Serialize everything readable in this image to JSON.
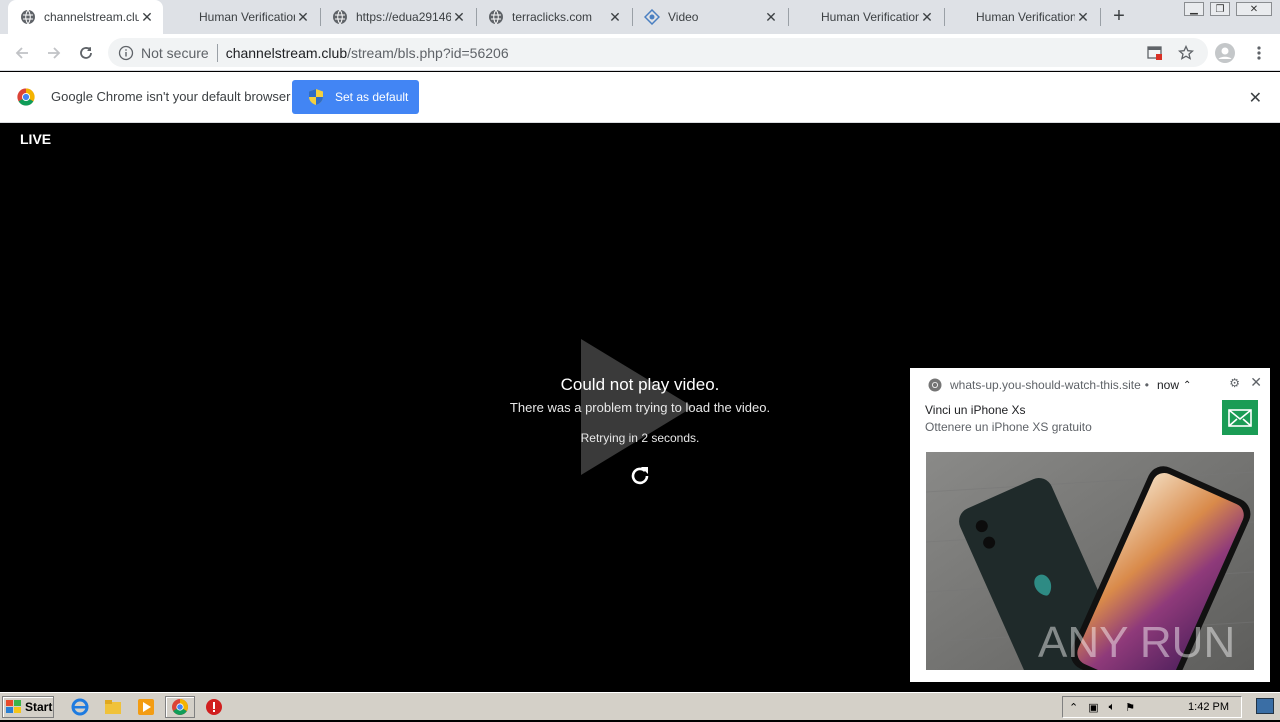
{
  "tabs": [
    {
      "title": "channelstream.club",
      "icon": "globe-icon",
      "active": true
    },
    {
      "title": "Human Verification",
      "icon": "none"
    },
    {
      "title": "https://edua29146",
      "icon": "globe-icon"
    },
    {
      "title": "terraclicks.com",
      "icon": "globe-icon"
    },
    {
      "title": "Video",
      "icon": "video-site-icon"
    },
    {
      "title": "Human Verification",
      "icon": "none"
    },
    {
      "title": "Human Verification",
      "icon": "none"
    }
  ],
  "toolbar": {
    "security_label": "Not secure",
    "url_host": "channelstream.club",
    "url_path": "/stream/bls.php?id=56206"
  },
  "infobar": {
    "message": "Google Chrome isn't your default browser",
    "button_label": "Set as default"
  },
  "video": {
    "live_label": "LIVE",
    "error_title": "Could not play video.",
    "error_message": "There was a problem trying to load the video.",
    "retry_text": "Retrying in 2 seconds."
  },
  "notification": {
    "origin": "whats-up.you-should-watch-this.site",
    "separator": "•",
    "time": "now",
    "title": "Vinci un iPhone Xs",
    "body": "Ottenere un iPhone XS gratuito",
    "watermark": "ANY RUN"
  },
  "taskbar": {
    "start_label": "Start",
    "clock": "1:42 PM"
  },
  "colors": {
    "accent": "#4285f4",
    "mail_icon_bg": "#1a9c55"
  }
}
